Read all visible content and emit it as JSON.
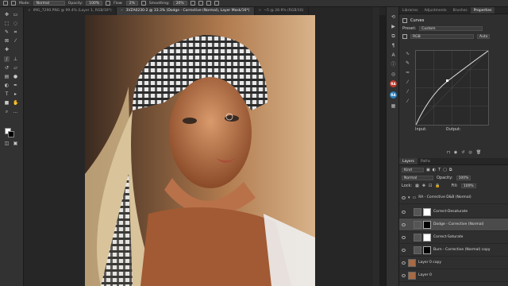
{
  "options_bar": {
    "mode_label": "Mode:",
    "mode_value": "Normal",
    "opacity_label": "Opacity:",
    "opacity_value": "100%",
    "flow_label": "Flow:",
    "flow_value": "2%",
    "smoothing_label": "Smoothing:",
    "smoothing_value": "20%"
  },
  "tabs": [
    {
      "label": "IMG_7290.PNG @ 99.4% (Layer 1, RGB/16*)"
    },
    {
      "label": "3VZA0230-2 @ 33.3% (Dodge - Corrective (Normal), Layer Mask/16*)"
    },
    {
      "label": "~5 @ 28.9% (RGB/16)"
    }
  ],
  "panel_tabs": [
    "Libraries",
    "Adjustments",
    "Brushes",
    "Properties"
  ],
  "properties": {
    "title": "Curves",
    "preset_label": "Preset:",
    "preset_value": "Custom",
    "channel_value": "RGB",
    "auto_label": "Auto",
    "input_label": "Input:",
    "output_label": "Output:"
  },
  "layers_tabs": [
    "Layers",
    "Paths"
  ],
  "layers": {
    "kind_value": "Kind",
    "blend_value": "Normal",
    "opacity_label": "Opacity:",
    "opacity_value": "100%",
    "lock_label": "Lock:",
    "fill_label": "Fill:",
    "fill_value": "100%",
    "items": [
      {
        "name": "RA - Corrective D&B (Normal)",
        "group": true,
        "selected": false
      },
      {
        "name": "Correct-Desaturate",
        "group": false,
        "selected": false
      },
      {
        "name": "Dodge - Corrective (Normal)",
        "group": false,
        "selected": true
      },
      {
        "name": "Correct-Saturate",
        "group": false,
        "selected": false
      },
      {
        "name": "Burn - Corrective (Normal) copy",
        "group": false,
        "selected": false
      },
      {
        "name": "Layer 0 copy",
        "group": false,
        "selected": false
      },
      {
        "name": "Layer 0",
        "group": false,
        "selected": false
      }
    ]
  },
  "side_badges": {
    "ra1": "RA",
    "ra2": "RA"
  },
  "colors": {
    "foreground": "#ffffff",
    "background": "#000000"
  }
}
